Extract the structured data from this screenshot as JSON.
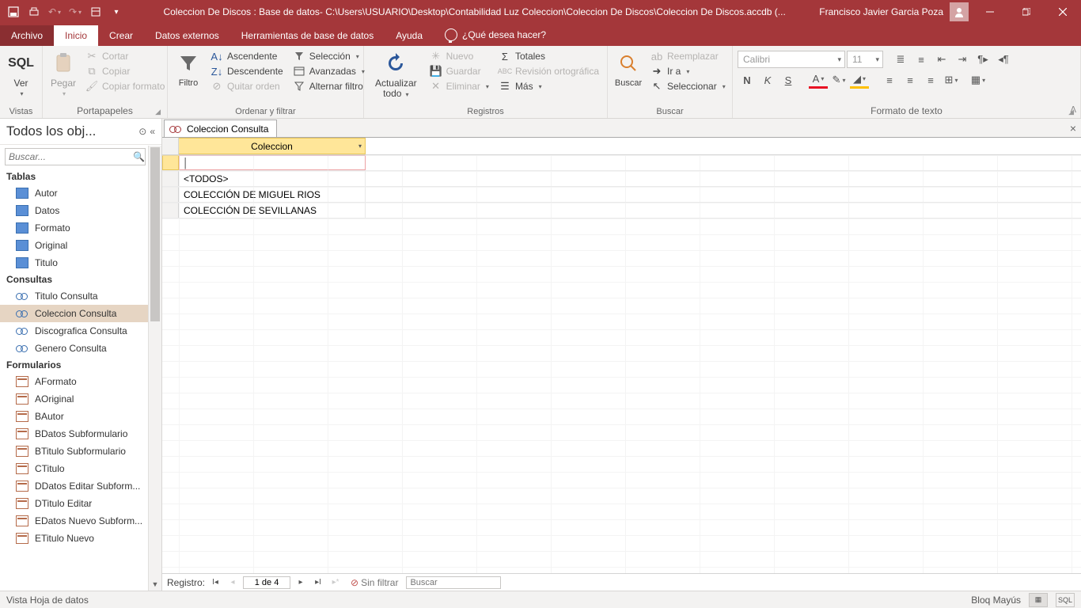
{
  "titlebar": {
    "title": "Coleccion De Discos : Base de datos- C:\\Users\\USUARIO\\Desktop\\Contabilidad Luz Coleccion\\Coleccion De Discos\\Coleccion De Discos.accdb (...",
    "user": "Francisco Javier Garcia Poza"
  },
  "tabs": {
    "file": "Archivo",
    "home": "Inicio",
    "create": "Crear",
    "external": "Datos externos",
    "dbtools": "Herramientas de base de datos",
    "help": "Ayuda",
    "tellme": "¿Qué desea hacer?"
  },
  "ribbon": {
    "views": {
      "label": "Vistas",
      "btn": "Ver",
      "big": "SQL"
    },
    "clipboard": {
      "label": "Portapapeles",
      "paste": "Pegar",
      "cut": "Cortar",
      "copy": "Copiar",
      "painter": "Copiar formato"
    },
    "sort": {
      "label": "Ordenar y filtrar",
      "filter": "Filtro",
      "asc": "Ascendente",
      "desc": "Descendente",
      "remove": "Quitar orden",
      "sel": "Selección",
      "adv": "Avanzadas",
      "toggle": "Alternar filtro"
    },
    "records": {
      "label": "Registros",
      "refresh": "Actualizar todo",
      "new": "Nuevo",
      "save": "Guardar",
      "delete": "Eliminar",
      "totals": "Totales",
      "spell": "Revisión ortográfica",
      "more": "Más"
    },
    "find": {
      "label": "Buscar",
      "find": "Buscar",
      "replace": "Reemplazar",
      "goto": "Ir a",
      "select": "Seleccionar"
    },
    "fmt": {
      "label": "Formato de texto",
      "font": "Calibri",
      "size": "11"
    }
  },
  "nav": {
    "title": "Todos los obj...",
    "search_ph": "Buscar...",
    "cats": {
      "tables": "Tablas",
      "queries": "Consultas",
      "forms": "Formularios"
    },
    "tables": [
      "Autor",
      "Datos",
      "Formato",
      "Original",
      "Titulo"
    ],
    "queries": [
      "Titulo Consulta",
      "Coleccion Consulta",
      "Discografica Consulta",
      "Genero Consulta"
    ],
    "forms": [
      "AFormato",
      "AOriginal",
      "BAutor",
      "BDatos Subformulario",
      "BTitulo Subformulario",
      "CTitulo",
      "DDatos Editar Subform...",
      "DTitulo Editar",
      "EDatos Nuevo Subform...",
      "ETitulo Nuevo"
    ],
    "selected": "Coleccion Consulta"
  },
  "doc": {
    "tab": "Coleccion Consulta",
    "col": "Coleccion",
    "rows": [
      "",
      "<TODOS>",
      "COLECCIÓN DE MIGUEL RIOS",
      "COLECCIÓN DE SEVILLANAS"
    ]
  },
  "recnav": {
    "label": "Registro:",
    "pos": "1 de 4",
    "filter": "Sin filtrar",
    "search": "Buscar"
  },
  "status": {
    "view": "Vista Hoja de datos",
    "caps": "Bloq Mayús",
    "sql": "SQL"
  }
}
